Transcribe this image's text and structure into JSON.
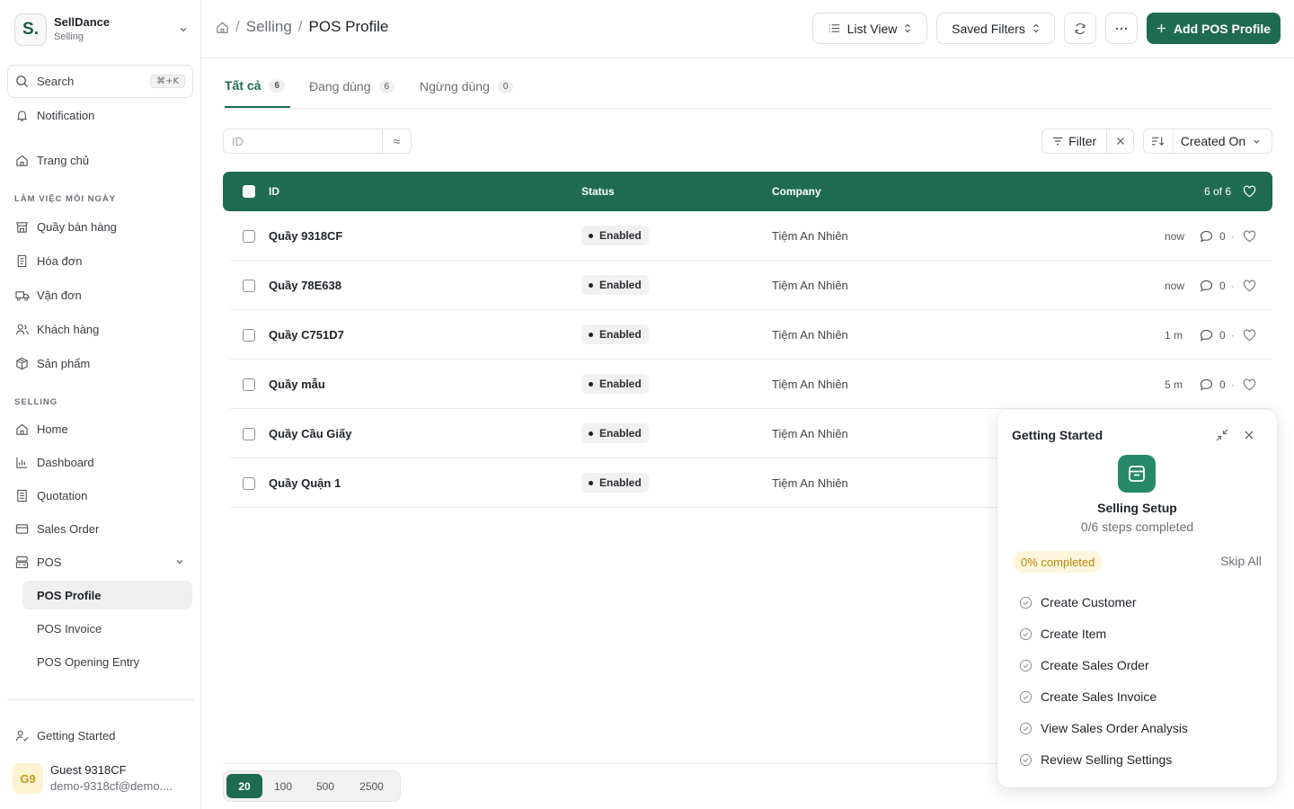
{
  "colors": {
    "brand": "#1e6b52",
    "accent_light": "#27896a",
    "badge_yellow": "#b8860b"
  },
  "sidebar": {
    "brand": {
      "logo": "S.",
      "name": "SellDance",
      "sub": "Selling"
    },
    "search": {
      "label": "Search",
      "shortcut": "⌘+K"
    },
    "notification": "Notification",
    "home": "Trang chủ",
    "section_daily": "LÀM VIỆC MỖI NGÀY",
    "daily": [
      {
        "label": "Quầy bán hàng",
        "icon": "store-icon"
      },
      {
        "label": "Hóa đơn",
        "icon": "receipt-icon"
      },
      {
        "label": "Vận đơn",
        "icon": "truck-icon"
      },
      {
        "label": "Khách hàng",
        "icon": "users-icon"
      },
      {
        "label": "Sản phẩm",
        "icon": "package-icon"
      }
    ],
    "section_selling": "SELLING",
    "selling": [
      {
        "label": "Home",
        "icon": "home-icon"
      },
      {
        "label": "Dashboard",
        "icon": "bar-chart-icon"
      },
      {
        "label": "Quotation",
        "icon": "document-icon"
      },
      {
        "label": "Sales Order",
        "icon": "card-icon"
      },
      {
        "label": "POS",
        "icon": "pos-icon"
      }
    ],
    "pos_sub": [
      "POS Profile",
      "POS Invoice",
      "POS Opening Entry"
    ],
    "getting_started": "Getting Started",
    "user": {
      "initials": "G9",
      "name": "Guest 9318CF",
      "email": "demo-9318cf@demo...."
    }
  },
  "header": {
    "crumbs": [
      "Selling",
      "POS Profile"
    ],
    "list_view": "List View",
    "saved_filters": "Saved Filters",
    "add_button": "Add POS Profile"
  },
  "tabs": [
    {
      "label": "Tất cả",
      "count": "6"
    },
    {
      "label": "Đang dùng",
      "count": "6"
    },
    {
      "label": "Ngừng dùng",
      "count": "0"
    }
  ],
  "filters": {
    "id_placeholder": "ID",
    "operator": "≈",
    "filter_label": "Filter",
    "sort_label": "Created On"
  },
  "table": {
    "columns": [
      "ID",
      "Status",
      "Company"
    ],
    "count": "6 of 6",
    "rows": [
      {
        "id": "Quầy 9318CF",
        "status": "Enabled",
        "company": "Tiệm An Nhiên",
        "time": "now",
        "comments": "0"
      },
      {
        "id": "Quầy 78E638",
        "status": "Enabled",
        "company": "Tiệm An Nhiên",
        "time": "now",
        "comments": "0"
      },
      {
        "id": "Quầy C751D7",
        "status": "Enabled",
        "company": "Tiệm An Nhiên",
        "time": "1 m",
        "comments": "0"
      },
      {
        "id": "Quầy mẫu",
        "status": "Enabled",
        "company": "Tiệm An Nhiên",
        "time": "5 m",
        "comments": "0"
      },
      {
        "id": "Quầy Cầu Giấy",
        "status": "Enabled",
        "company": "Tiệm An Nhiên",
        "time": "",
        "comments": ""
      },
      {
        "id": "Quầy Quận 1",
        "status": "Enabled",
        "company": "Tiệm An Nhiên",
        "time": "",
        "comments": ""
      }
    ]
  },
  "pager": [
    "20",
    "100",
    "500",
    "2500"
  ],
  "getting_started": {
    "title": "Getting Started",
    "heading": "Selling Setup",
    "progress": "0/6 steps completed",
    "percent": "0% completed",
    "skip": "Skip All",
    "steps": [
      "Create Customer",
      "Create Item",
      "Create Sales Order",
      "Create Sales Invoice",
      "View Sales Order Analysis",
      "Review Selling Settings"
    ]
  }
}
